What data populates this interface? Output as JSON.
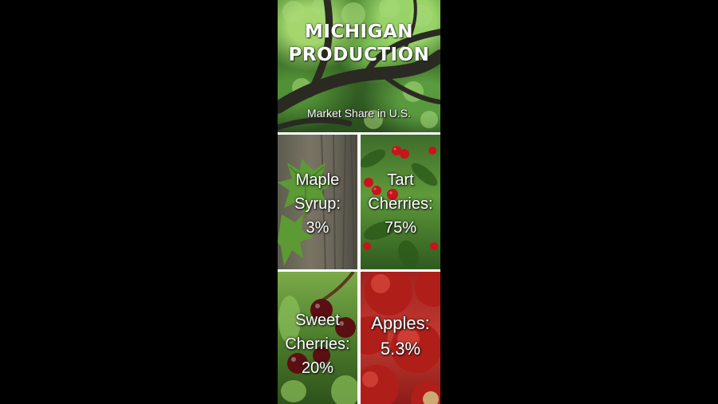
{
  "header": {
    "title_line1": "MICHIGAN",
    "title_line2": "PRODUCTION",
    "subtitle": "Market Share in U.S."
  },
  "tiles": [
    {
      "lines": [
        "Maple",
        "Syrup:",
        "3%"
      ]
    },
    {
      "lines": [
        "Tart",
        "Cherries:",
        "75%"
      ]
    },
    {
      "lines": [
        "Sweet",
        "Cherries:",
        "20%"
      ]
    },
    {
      "lines": [
        "Apples:",
        "5.3%"
      ]
    }
  ],
  "colors": {
    "background": "#000000",
    "divider": "#ffffff",
    "text": "#ffffff"
  }
}
